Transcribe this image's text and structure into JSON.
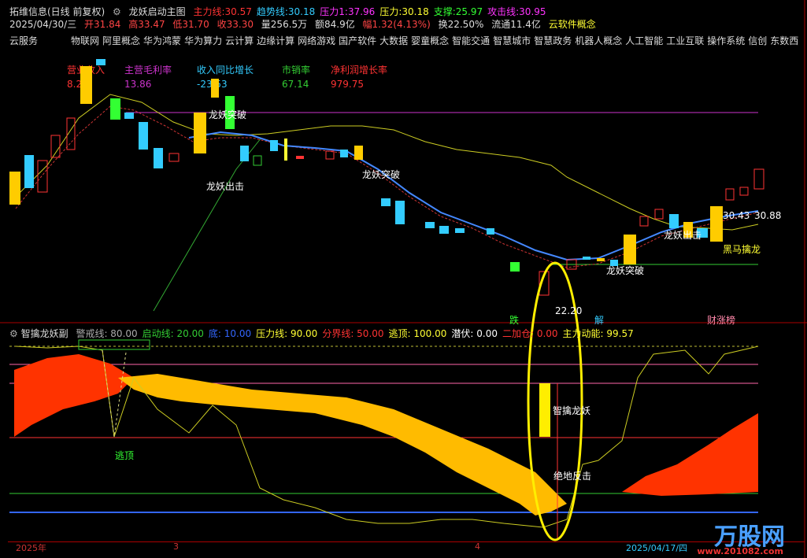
{
  "header": {
    "app": "拓维信息(日线 前复权)",
    "indicator": "龙妖启动主图",
    "items": [
      {
        "label": "主力线:",
        "value": "30.57",
        "color": "#ff3333"
      },
      {
        "label": "趋势线:",
        "value": "30.18",
        "color": "#33ccff"
      },
      {
        "label": "压力1:",
        "value": "37.96",
        "color": "#ff33ff"
      },
      {
        "label": "压力:",
        "value": "30.18",
        "color": "#ffff33"
      },
      {
        "label": "支撑:",
        "value": "25.97",
        "color": "#33ff33"
      },
      {
        "label": "攻击线:",
        "value": "30.95",
        "color": "#ff33ff"
      }
    ]
  },
  "quote": {
    "date": "2025/04/30/三",
    "open": "开31.84",
    "high": "高33.47",
    "low": "低31.70",
    "close": "收33.30",
    "volume": "量256.5万",
    "amount": "额84.9亿",
    "change": "幅1.32(4.13%)",
    "turnover": "换22.50%",
    "float": "流通11.4亿",
    "source": "云软件概念"
  },
  "concepts": [
    "云服务",
    "物联网",
    "阿里概念",
    "华为鸿蒙",
    "华为算力",
    "云计算",
    "边缘计算",
    "网络游戏",
    "国产软件",
    "大数据",
    "婴童概念",
    "智能交通",
    "智慧城市",
    "智慧政务",
    "机器人概念",
    "人工智能",
    "工业互联",
    "操作系统",
    "信创",
    "东数西"
  ],
  "fundamentals": [
    {
      "label": "营业收入",
      "value": "8.23",
      "color": "#ff3333"
    },
    {
      "label": "主营毛利率",
      "value": "13.86",
      "color": "#cc33cc"
    },
    {
      "label": "收入同比增长",
      "value": "-23.53",
      "color": "#33ccff"
    },
    {
      "label": "市销率",
      "value": "67.14",
      "color": "#33cc33"
    },
    {
      "label": "净利润增长率",
      "value": "979.75",
      "color": "#ff3333"
    }
  ],
  "annotations": {
    "breakout1": "龙妖突破",
    "breakout2": "龙妖突破",
    "breakout3": "龙妖突破",
    "strike1": "龙妖出击",
    "strike2": "龙妖出击",
    "black_horse": "黑马擒龙",
    "low_price": "22.20",
    "price_left": "30.43",
    "price_right": "30.88",
    "die": "跌",
    "jie": "解",
    "caizhang": "财涨榜"
  },
  "sub_panel": {
    "title": "智擒龙妖副",
    "items": [
      {
        "label": "警戒线:",
        "value": "80.00",
        "color": "#aaaaaa"
      },
      {
        "label": "启动线:",
        "value": "20.00",
        "color": "#33cc33"
      },
      {
        "label": "底:",
        "value": "10.00",
        "color": "#3366ff"
      },
      {
        "label": "压力线:",
        "value": "90.00",
        "color": "#ffff33"
      },
      {
        "label": "分界线:",
        "value": "50.00",
        "color": "#ff3333"
      },
      {
        "label": "逃顶:",
        "value": "100.00",
        "color": "#ffff33"
      },
      {
        "label": "潜伏:",
        "value": "0.00",
        "color": "#ffffff"
      },
      {
        "label": "二加仓:",
        "value": "0.00",
        "color": "#ff3333"
      },
      {
        "label": "主力动能:",
        "value": "99.57",
        "color": "#ffff33"
      }
    ],
    "escape": "逃顶",
    "capture": "智擒龙妖",
    "bottom_strike": "绝地反击"
  },
  "axis": {
    "year": "2025年",
    "m3": "3",
    "m4": "4",
    "date": "2025/04/17/四"
  },
  "logo": {
    "name": "万股网",
    "url": "www.201082.com"
  }
}
